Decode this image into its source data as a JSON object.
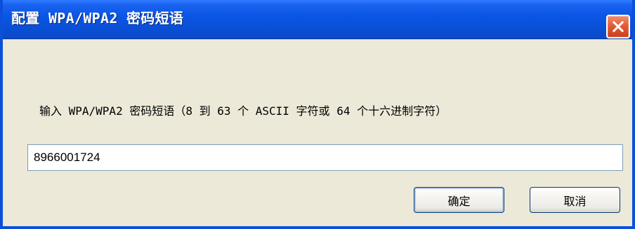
{
  "window": {
    "title": "配置 WPA/WPA2 密码短语",
    "close_icon": "close-icon"
  },
  "dialog": {
    "prompt": "输入 WPA/WPA2 密码短语（8 到 63 个 ASCII 字符或 64 个十六进制字符）",
    "passphrase_value": "8966001724"
  },
  "buttons": {
    "ok_label": "确定",
    "cancel_label": "取消"
  },
  "colors": {
    "titlebar": "#0a50d8",
    "close_button": "#e35c37",
    "window_background": "#ece9d8"
  }
}
